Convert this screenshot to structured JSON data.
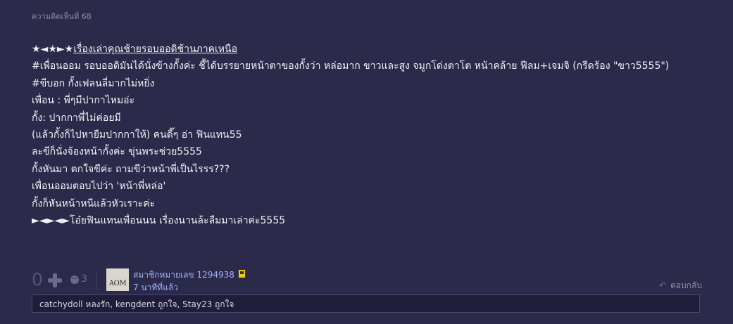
{
  "comment": {
    "number_label": "ความคิดเห็นที่ 68",
    "title_prefix": "★◄★►★",
    "title": "เรื่องเล่าคุณช้ายรอบออดิช้านภาคเหนือ",
    "lines": [
      "#เพื่อนออม รอบออดิมันได้นั่งข้างกั้งค่ะ ชี้ได้บรรยายหน้าตาของกั้งว่า  หล่อมาก ขาวและสูง จมูกโด่งตาโต หน้าคล้าย ฟีลม+เจมจิ (กรีดร้อง \"ขาว5555\")",
      "#ขีบอก กั้งเฟลนลี่มากไม่หยิ่ง",
      "เพื่อน : พี่ๆมีปากาไหมอ่ะ",
      "กั้ง: ปากกาพี่ไม่ค่อยมี",
      "(แล้วกั้งก็ไปหายืมปากกาให้) คนดี๊ๆ อ่า ฟินแทน55",
      "ละขีก็นั่งจ้องหน้ากั้งค่ะ ขุ่นพระช่วย5555",
      "กั้งหันมา ตกใจขีค่ะ ถามขีว่าหน้าพี่เป็นไรรร???",
      "เพื่อนออมตอบไปว่า  'หน้าพี่หล่อ'",
      "กั้งก็หันหน้าหนีแล้วหัวเราะค่ะ",
      "►◄►◄►โอ๋ยฟินแทนเพื่อนนน  เรื่องนานล้ะลืมมาเล่าค่ะ5555"
    ]
  },
  "footer": {
    "score": "0",
    "emotion_count": "3",
    "avatar_text": "AOM",
    "member": "สมาชิกหมายเลข 1294938",
    "time": "7 นาทีที่แล้ว",
    "reply_label": "ตอบกลับ"
  },
  "reactions": "catchydoll หลงรัก, kengdent ถูกใจ, Stay23 ถูกใจ"
}
